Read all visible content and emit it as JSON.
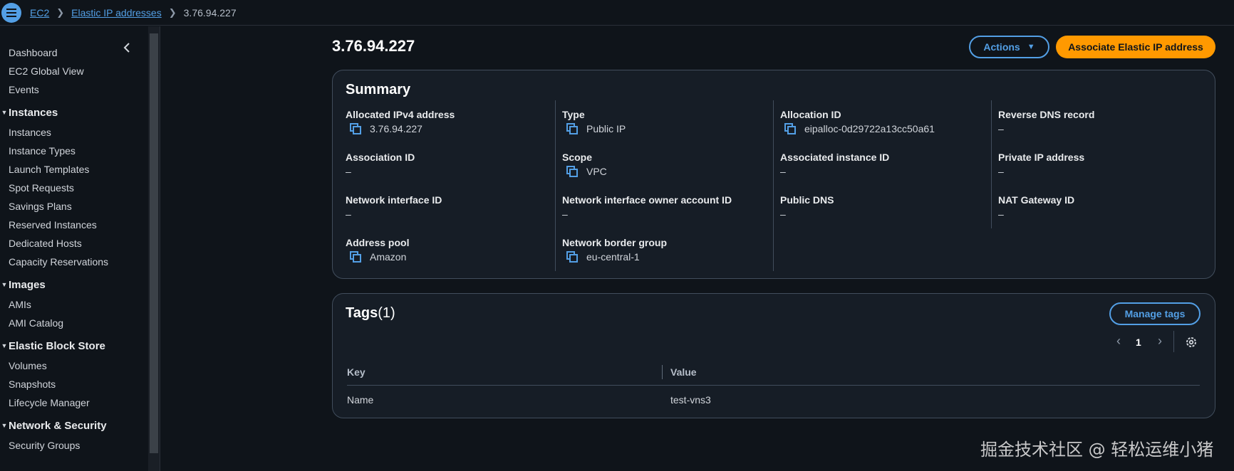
{
  "breadcrumb": {
    "items": [
      "EC2",
      "Elastic IP addresses"
    ],
    "current": "3.76.94.227"
  },
  "sidebar": {
    "top_items": [
      "Dashboard",
      "EC2 Global View",
      "Events"
    ],
    "sections": [
      {
        "title": "Instances",
        "items": [
          "Instances",
          "Instance Types",
          "Launch Templates",
          "Spot Requests",
          "Savings Plans",
          "Reserved Instances",
          "Dedicated Hosts",
          "Capacity Reservations"
        ]
      },
      {
        "title": "Images",
        "items": [
          "AMIs",
          "AMI Catalog"
        ]
      },
      {
        "title": "Elastic Block Store",
        "items": [
          "Volumes",
          "Snapshots",
          "Lifecycle Manager"
        ]
      },
      {
        "title": "Network & Security",
        "items": [
          "Security Groups"
        ]
      }
    ]
  },
  "page": {
    "title": "3.76.94.227",
    "actions_label": "Actions",
    "associate_label": "Associate Elastic IP address"
  },
  "summary": {
    "heading": "Summary",
    "columns": [
      [
        {
          "label": "Allocated IPv4 address",
          "value": "3.76.94.227",
          "copy": true
        },
        {
          "label": "Association ID",
          "value": "–",
          "copy": false
        },
        {
          "label": "Network interface ID",
          "value": "–",
          "copy": false
        },
        {
          "label": "Address pool",
          "value": "Amazon",
          "copy": true
        }
      ],
      [
        {
          "label": "Type",
          "value": "Public IP",
          "copy": true
        },
        {
          "label": "Scope",
          "value": "VPC",
          "copy": true
        },
        {
          "label": "Network interface owner account ID",
          "value": "–",
          "copy": false
        },
        {
          "label": "Network border group",
          "value": "eu-central-1",
          "copy": true
        }
      ],
      [
        {
          "label": "Allocation ID",
          "value": "eipalloc-0d29722a13cc50a61",
          "copy": true
        },
        {
          "label": "Associated instance ID",
          "value": "–",
          "copy": false
        },
        {
          "label": "Public DNS",
          "value": "–",
          "copy": false
        }
      ],
      [
        {
          "label": "Reverse DNS record",
          "value": "–",
          "copy": false
        },
        {
          "label": "Private IP address",
          "value": "–",
          "copy": false
        },
        {
          "label": "NAT Gateway ID",
          "value": "–",
          "copy": false
        }
      ]
    ]
  },
  "tags": {
    "heading": "Tags",
    "count": "(1)",
    "manage_label": "Manage tags",
    "page_number": "1",
    "columns": [
      "Key",
      "Value"
    ],
    "rows": [
      {
        "key": "Name",
        "value": "test-vns3"
      }
    ]
  },
  "watermark": "掘金技术社区 @ 轻松运维小猪",
  "colors": {
    "accent": "#539fe5",
    "primary_button": "#ff9900",
    "background": "#0f141a",
    "panel": "#161d26"
  }
}
